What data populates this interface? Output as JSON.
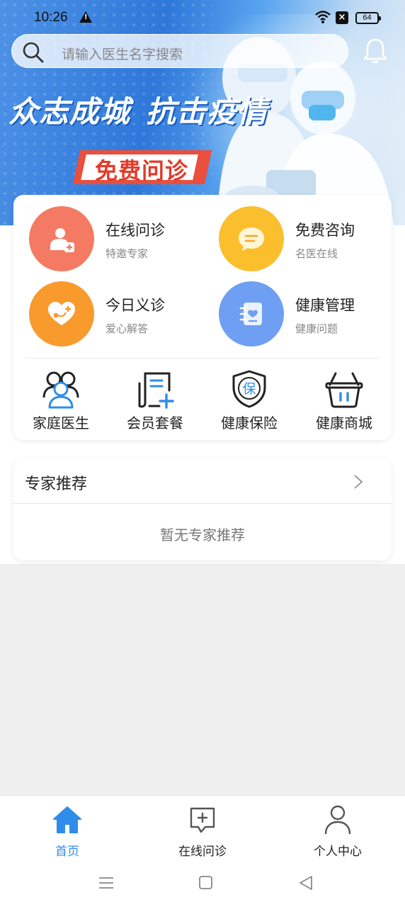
{
  "status_bar": {
    "time": "10:26",
    "battery": "64"
  },
  "banner": {
    "slogan_part1": "众志成城",
    "slogan_part2": "抗击疫情",
    "tag": "免费问诊"
  },
  "search": {
    "placeholder": "请输入医生名字搜索"
  },
  "features": [
    {
      "title": "在线问诊",
      "subtitle": "特邀专家",
      "icon": "doctor-plus-icon",
      "color": "#f57a63"
    },
    {
      "title": "免费咨询",
      "subtitle": "名医在线",
      "icon": "chat-bubble-icon",
      "color": "#fbbf2e"
    },
    {
      "title": "今日义诊",
      "subtitle": "爱心解答",
      "icon": "heart-stethoscope-icon",
      "color": "#f99a2c"
    },
    {
      "title": "健康管理",
      "subtitle": "健康问题",
      "icon": "health-record-icon",
      "color": "#6e9ff2"
    }
  ],
  "services": [
    {
      "label": "家庭医生",
      "icon": "family-doctor-icon"
    },
    {
      "label": "会员套餐",
      "icon": "member-package-icon"
    },
    {
      "label": "健康保险",
      "icon": "insurance-shield-icon"
    },
    {
      "label": "健康商城",
      "icon": "shopping-basket-icon"
    }
  ],
  "experts": {
    "title": "专家推荐",
    "empty_text": "暂无专家推荐"
  },
  "tabs": [
    {
      "label": "首页",
      "icon": "home-icon",
      "active": true
    },
    {
      "label": "在线问诊",
      "icon": "consult-chat-icon",
      "active": false
    },
    {
      "label": "个人中心",
      "icon": "person-icon",
      "active": false
    }
  ],
  "colors": {
    "accent": "#2e8de8",
    "service_icon_blue": "#2e8de8"
  }
}
